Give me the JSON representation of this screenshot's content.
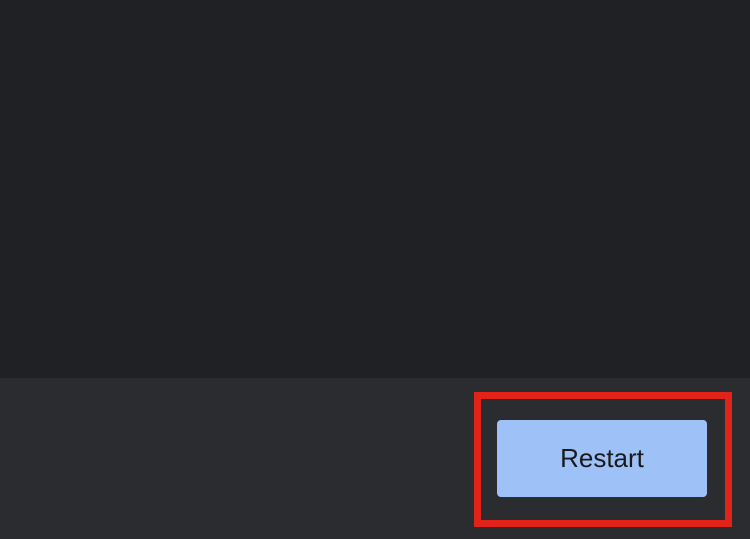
{
  "footer": {
    "restart_label": "Restart"
  }
}
